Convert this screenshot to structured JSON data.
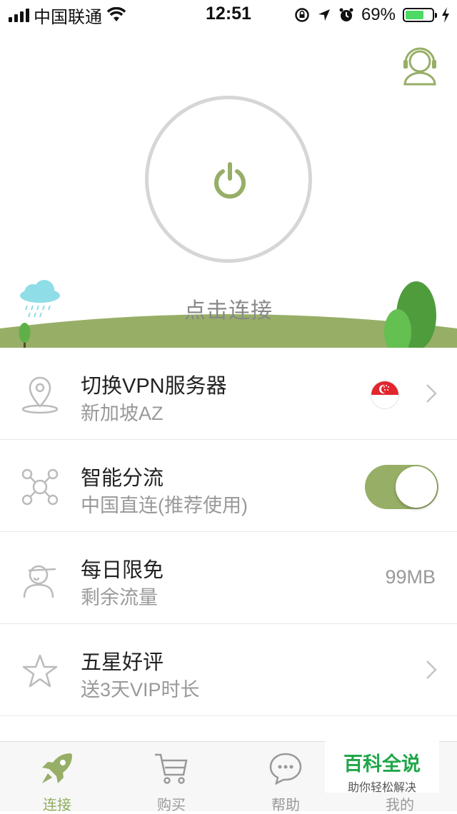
{
  "status_bar": {
    "carrier": "中国联通",
    "time": "12:51",
    "battery": "69%",
    "battery_level": 0.69,
    "icons": [
      "signal-icon",
      "wifi-icon",
      "rotation-lock-icon",
      "location-icon",
      "alarm-icon",
      "battery-icon",
      "charging-icon"
    ]
  },
  "hero": {
    "connect_label": "点击连接",
    "icons": [
      "support-icon",
      "power-icon",
      "rain-cloud-icon",
      "tree-icon"
    ]
  },
  "rows": [
    {
      "title": "切换VPN服务器",
      "subtitle": "新加坡AZ",
      "icon": "location-pin-icon"
    },
    {
      "title": "智能分流",
      "subtitle": "中国直连(推荐使用)",
      "icon": "network-nodes-icon",
      "toggle_on": true
    },
    {
      "title": "每日限免",
      "subtitle": "剩余流量",
      "value": "99MB",
      "icon": "user-cap-icon"
    },
    {
      "title": "五星好评",
      "subtitle": "送3天VIP时长",
      "icon": "star-icon"
    }
  ],
  "tabs": [
    {
      "label": "连接",
      "icon": "rocket-icon",
      "active": true
    },
    {
      "label": "购买",
      "icon": "cart-icon"
    },
    {
      "label": "帮助",
      "icon": "chat-icon"
    },
    {
      "label": "我的",
      "icon": "profile-icon"
    }
  ],
  "watermark": {
    "title": "百科全说",
    "subtitle": "助你轻松解决"
  },
  "colors": {
    "accent": "#97ae67",
    "accent_text": "#8fac5e",
    "flag_red": "#e1262d",
    "ring": "#d6d6d6"
  }
}
